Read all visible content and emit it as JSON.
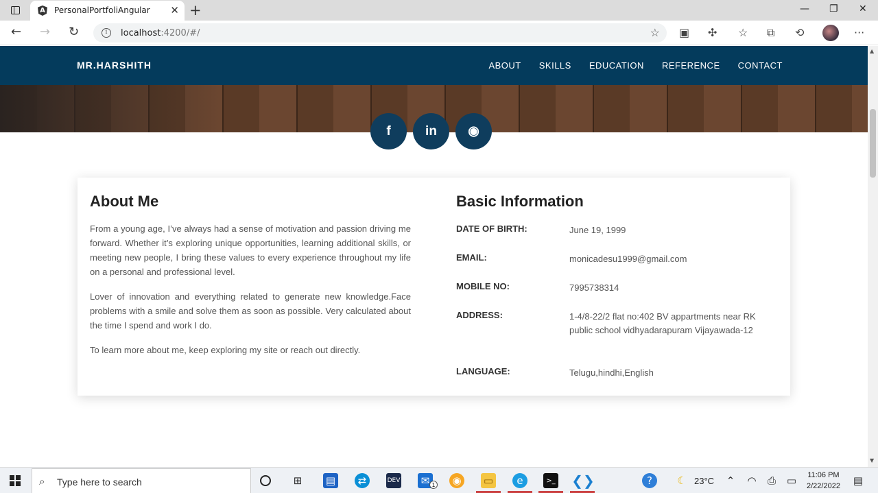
{
  "browser": {
    "tab_title": "PersonalPortfoliAngular",
    "favicon_letter": "A",
    "url_host": "localhost",
    "url_rest": ":4200/#/"
  },
  "navbar": {
    "brand": "MR.HARSHITH",
    "links": [
      "ABOUT",
      "SKILLS",
      "EDUCATION",
      "REFERENCE",
      "CONTACT"
    ]
  },
  "social": {
    "facebook": "f",
    "linkedin": "in",
    "github": "◉"
  },
  "about": {
    "title": "About Me",
    "paragraphs": [
      "From a young age, I’ve always had a sense of motivation and passion driving me forward. Whether it’s exploring unique opportunities, learning additional skills, or meeting new people, I bring these values to every experience throughout my life on a personal and professional level.",
      "Lover of innovation and everything related to generate new knowledge.Face problems with a smile and solve them as soon as possible. Very calculated about the time I spend and work I do.",
      "To learn more about me, keep exploring my site or reach out directly."
    ]
  },
  "basic_info": {
    "title": "Basic Information",
    "rows": [
      {
        "key": "DATE OF BIRTH:",
        "value": "June 19, 1999"
      },
      {
        "key": "EMAIL:",
        "value": "monicadesu1999@gmail.com"
      },
      {
        "key": "MOBILE NO:",
        "value": "7995738314"
      },
      {
        "key": "ADDRESS:",
        "value": "1-4/8-22/2 flat no:402 BV appartments near RK public school vidhyadarapuram Vijayawada-12"
      },
      {
        "key": "LANGUAGE:",
        "value": "Telugu,hindhi,English"
      }
    ]
  },
  "taskbar": {
    "search_placeholder": "Type here to search",
    "temperature": "23°C",
    "time": "11:06 PM",
    "date": "2/22/2022",
    "mail_badge": "1"
  }
}
